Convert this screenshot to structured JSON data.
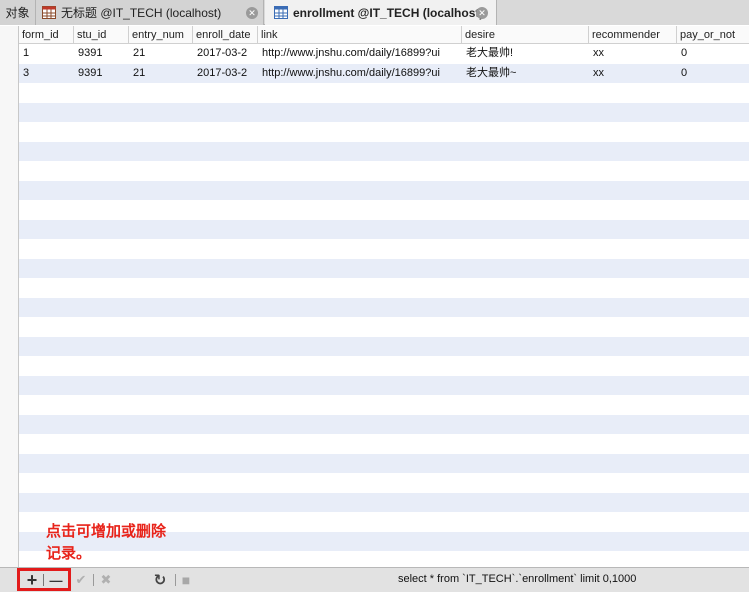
{
  "tabs": {
    "objects_label": "对象",
    "untitled_label": "无标题 @IT_TECH (localhost)",
    "enrollment_label": "enrollment @IT_TECH (localhost)",
    "close_glyph": "✕"
  },
  "table": {
    "columns": [
      "form_id",
      "stu_id",
      "entry_num",
      "enroll_date",
      "link",
      "desire",
      "recommender",
      "pay_or_not"
    ],
    "rows": [
      [
        "1",
        "9391",
        "21",
        "2017-03-2",
        "http://www.jnshu.com/daily/16899?ui",
        "老大最帅!",
        "xx",
        "0"
      ],
      [
        "3",
        "9391",
        "21",
        "2017-03-2",
        "http://www.jnshu.com/daily/16899?ui",
        "老大最帅~",
        "xx",
        "0"
      ]
    ]
  },
  "annotation": {
    "line1": "点击可增加或删除",
    "line2": "记录。"
  },
  "toolbar": {
    "add_glyph": "+",
    "remove_glyph": "—",
    "apply_glyph": "✔",
    "discard_glyph": "✖",
    "refresh_glyph": "↻",
    "stop_glyph": "■",
    "status_sql": "select * from `IT_TECH`.`enrollment`  limit 0,1000"
  },
  "colors": {
    "stripe": "#e8edf8",
    "annotation": "#e8231a",
    "highlight": "#e21b1b"
  }
}
